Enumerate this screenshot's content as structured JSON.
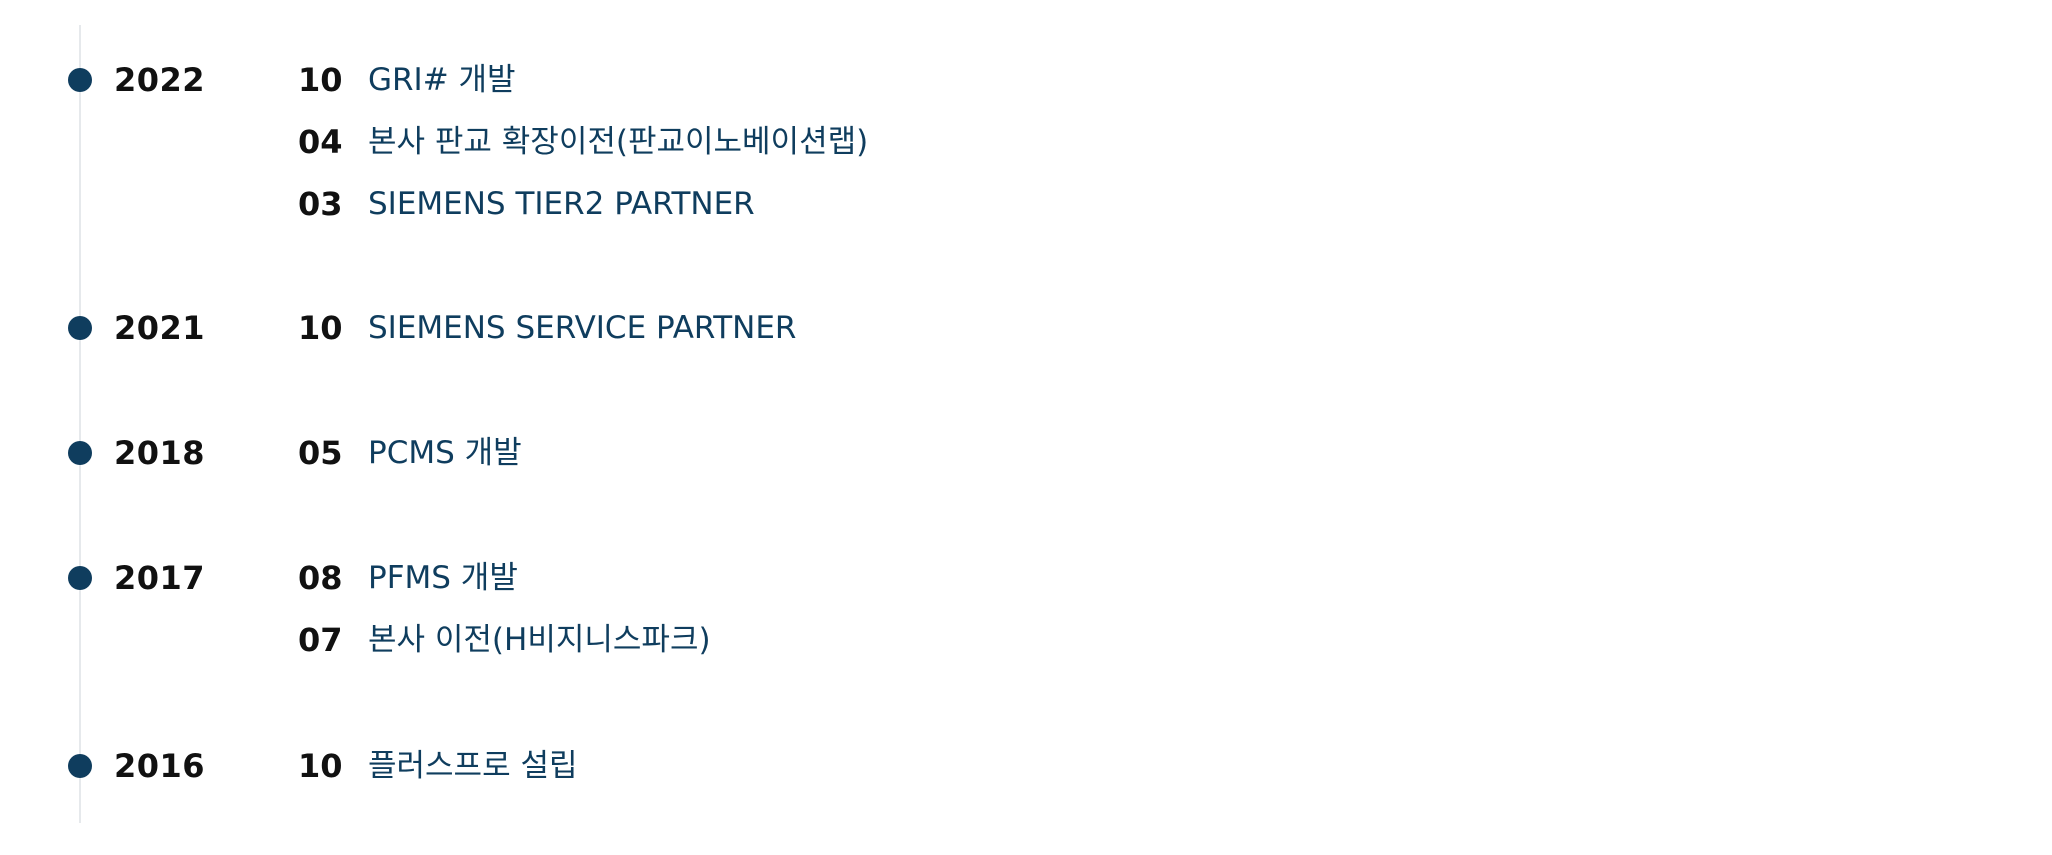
{
  "timeline": [
    {
      "year": "2022",
      "events": [
        {
          "month": "10",
          "text": "GRI# 개발"
        },
        {
          "month": "04",
          "text": "본사 판교 확장이전(판교이노베이션랩)"
        },
        {
          "month": "03",
          "text": "SIEMENS TIER2 PARTNER"
        }
      ]
    },
    {
      "year": "2021",
      "events": [
        {
          "month": "10",
          "text": "SIEMENS SERVICE PARTNER"
        }
      ]
    },
    {
      "year": "2018",
      "events": [
        {
          "month": "05",
          "text": "PCMS 개발"
        }
      ]
    },
    {
      "year": "2017",
      "events": [
        {
          "month": "08",
          "text": "PFMS 개발"
        },
        {
          "month": "07",
          "text": "본사 이전(H비지니스파크)"
        }
      ]
    },
    {
      "year": "2016",
      "events": [
        {
          "month": "10",
          "text": "플러스프로 설립"
        }
      ]
    }
  ],
  "colors": {
    "accent": "#0f3d5e",
    "text": "#111111",
    "line": "#e6e9ec"
  }
}
